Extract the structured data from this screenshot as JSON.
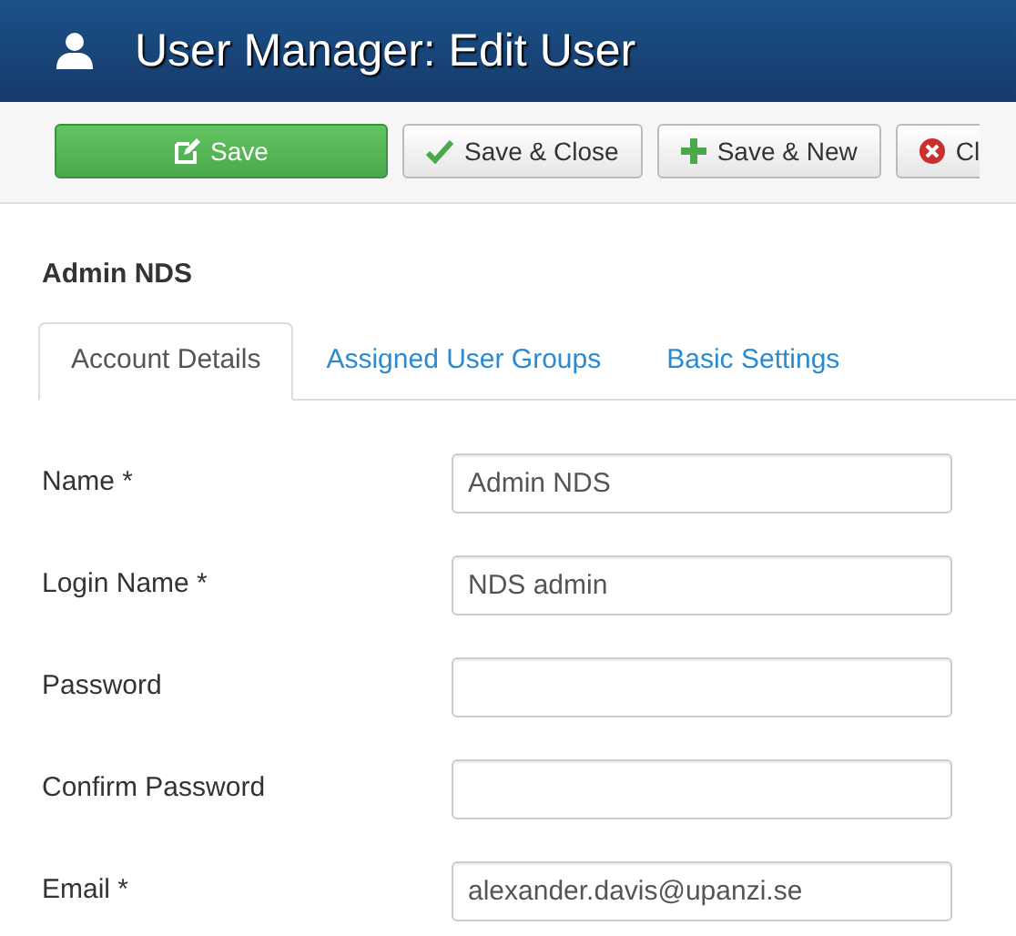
{
  "header": {
    "title": "User Manager: Edit User"
  },
  "toolbar": [
    {
      "label": "Save",
      "kind": "apply"
    },
    {
      "label": "Save & Close",
      "kind": "save"
    },
    {
      "label": "Save & New",
      "kind": "new"
    },
    {
      "label": "Cl",
      "kind": "cancel"
    }
  ],
  "heading": "Admin NDS",
  "tabs": [
    {
      "label": "Account Details",
      "selected": true
    },
    {
      "label": "Assigned User Groups",
      "selected": false
    },
    {
      "label": "Basic Settings",
      "selected": false
    }
  ],
  "fields": [
    {
      "label": "Name *",
      "value": "Admin NDS"
    },
    {
      "label": "Login Name *",
      "value": "NDS admin"
    },
    {
      "label": "Password"
    },
    {
      "label": "Confirm Password"
    },
    {
      "label": "Email *",
      "value": "alexander.davis@upanzi.se"
    }
  ]
}
